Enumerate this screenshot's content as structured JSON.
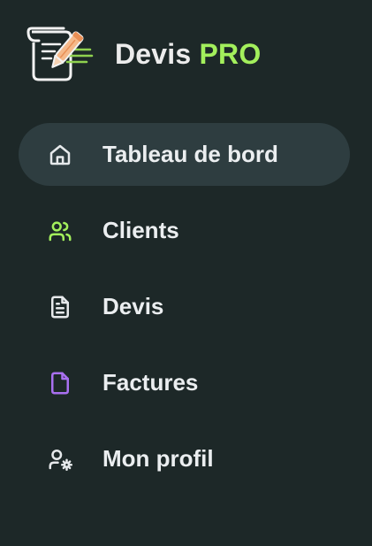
{
  "brand": {
    "name": "Devis",
    "suffix": "PRO",
    "logo_icon": "quill-document-icon"
  },
  "colors": {
    "background": "#1d2828",
    "active_item": "#2e3d40",
    "accent_green": "#a3ef5c",
    "accent_purple": "#a970f0",
    "text": "#ebeef0"
  },
  "nav": {
    "items": [
      {
        "label": "Tableau de bord",
        "icon": "home-icon",
        "active": true
      },
      {
        "label": "Clients",
        "icon": "users-icon",
        "active": false
      },
      {
        "label": "Devis",
        "icon": "file-text-icon",
        "active": false
      },
      {
        "label": "Factures",
        "icon": "file-icon",
        "active": false
      },
      {
        "label": "Mon profil",
        "icon": "user-cog-icon",
        "active": false
      }
    ]
  }
}
